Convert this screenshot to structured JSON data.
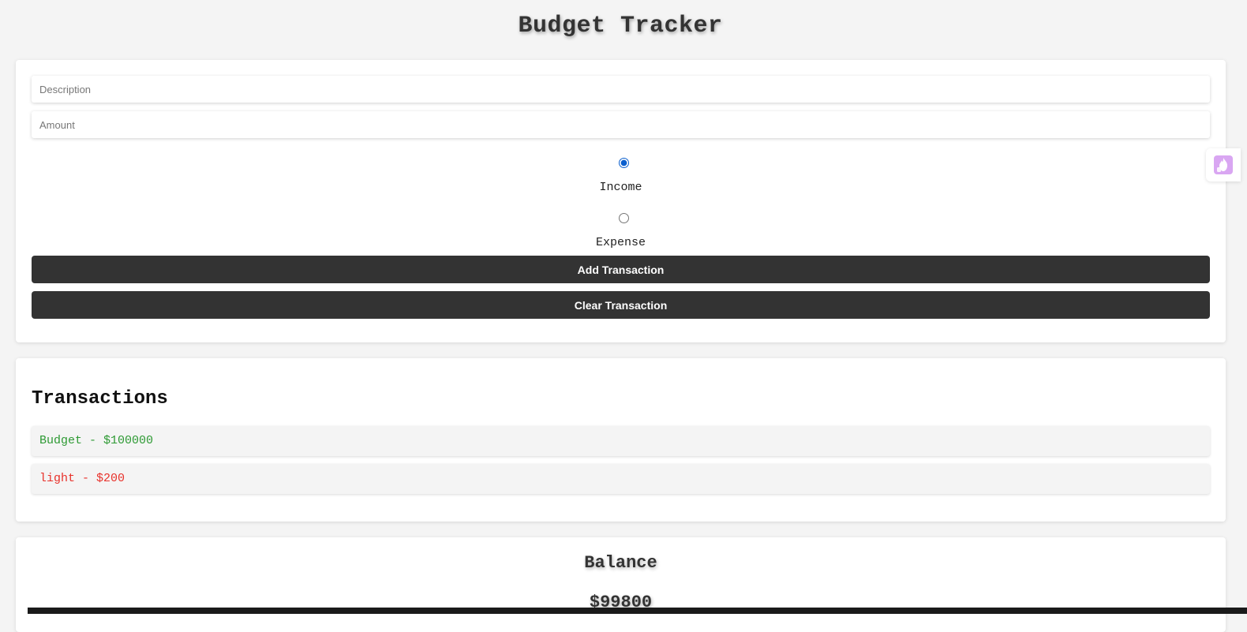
{
  "app": {
    "title": "Budget Tracker"
  },
  "form": {
    "description_placeholder": "Description",
    "description_value": "",
    "amount_placeholder": "Amount",
    "amount_value": "",
    "type_options": [
      {
        "label": "Income",
        "selected": true
      },
      {
        "label": "Expense",
        "selected": false
      }
    ],
    "add_button_label": "Add Transaction",
    "clear_button_label": "Clear Transaction"
  },
  "transactions": {
    "heading": "Transactions",
    "items": [
      {
        "text": "Budget - $100000",
        "type": "income",
        "color": "#2e9a34"
      },
      {
        "text": "light - $200",
        "type": "expense",
        "color": "#e8322b"
      }
    ]
  },
  "balance": {
    "heading": "Balance",
    "amount": "$99800"
  },
  "colors": {
    "background": "#f4f4f4",
    "button": "#333333",
    "income": "#2e9a34",
    "expense": "#e8322b",
    "radio_accent": "#0b5fce",
    "widget_accent": "#c77bea"
  },
  "icons": {
    "side_widget": "hand-flame-icon"
  }
}
